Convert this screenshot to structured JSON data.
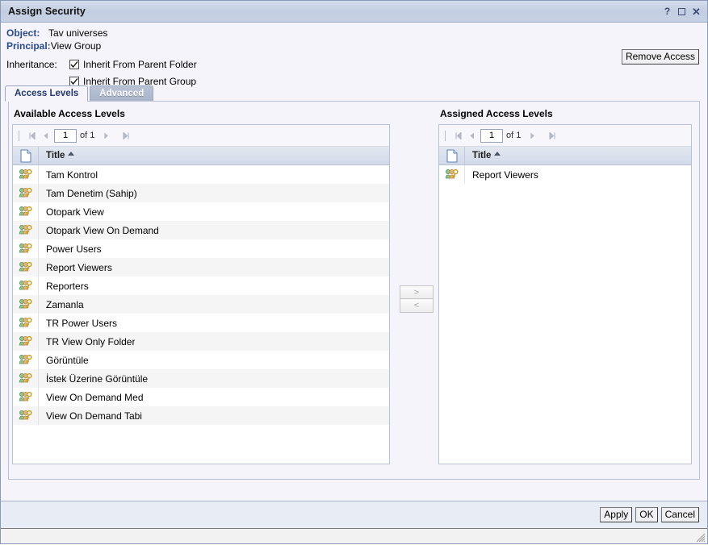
{
  "window": {
    "title": "Assign Security",
    "controls": [
      {
        "name": "help-icon",
        "glyph": "?"
      },
      {
        "name": "maximize-icon",
        "glyph": ""
      },
      {
        "name": "close-icon",
        "glyph": "✕"
      }
    ]
  },
  "header": {
    "object_label": "Object:",
    "object_value": "Tav universes",
    "principal_label": "Principal:",
    "principal_value": "View Group",
    "inheritance_label": "Inheritance:",
    "inherit_folder": {
      "label": "Inherit From Parent Folder",
      "checked": true
    },
    "inherit_group": {
      "label": "Inherit From Parent Group",
      "checked": true
    },
    "remove_access_label": "Remove Access"
  },
  "tabs": [
    {
      "label": "Access Levels",
      "active": true
    },
    {
      "label": "Advanced",
      "active": false
    }
  ],
  "available": {
    "title": "Available Access Levels",
    "pager": {
      "page": "1",
      "of_label": "of 1"
    },
    "columns": {
      "icon": "document-icon",
      "title": "Title"
    },
    "sort": "ascending",
    "rows": [
      {
        "title": "Tam Kontrol"
      },
      {
        "title": "Tam Denetim (Sahip)"
      },
      {
        "title": "Otopark View"
      },
      {
        "title": "Otopark View On Demand"
      },
      {
        "title": "Power Users"
      },
      {
        "title": "Report Viewers"
      },
      {
        "title": "Reporters"
      },
      {
        "title": "Zamanla"
      },
      {
        "title": "TR Power Users"
      },
      {
        "title": "TR View Only Folder"
      },
      {
        "title": "Görüntüle"
      },
      {
        "title": "İstek Üzerine Görüntüle"
      },
      {
        "title": "View On Demand Med"
      },
      {
        "title": "View On Demand Tabi"
      }
    ]
  },
  "transfer": {
    "add_label": ">",
    "remove_label": "<"
  },
  "assigned": {
    "title": "Assigned Access Levels",
    "pager": {
      "page": "1",
      "of_label": "of 1"
    },
    "columns": {
      "icon": "document-icon",
      "title": "Title"
    },
    "sort": "ascending",
    "rows": [
      {
        "title": "Report Viewers"
      }
    ]
  },
  "footer": {
    "apply_label": "Apply",
    "ok_label": "OK",
    "cancel_label": "Cancel"
  },
  "colors": {
    "titlebar": "#c3cee2",
    "accent_blue": "#2a4b8d",
    "panel_bg": "#f4f4fa",
    "row_alt": "#f5f5f5",
    "footer_bg": "#e8ecf4"
  }
}
